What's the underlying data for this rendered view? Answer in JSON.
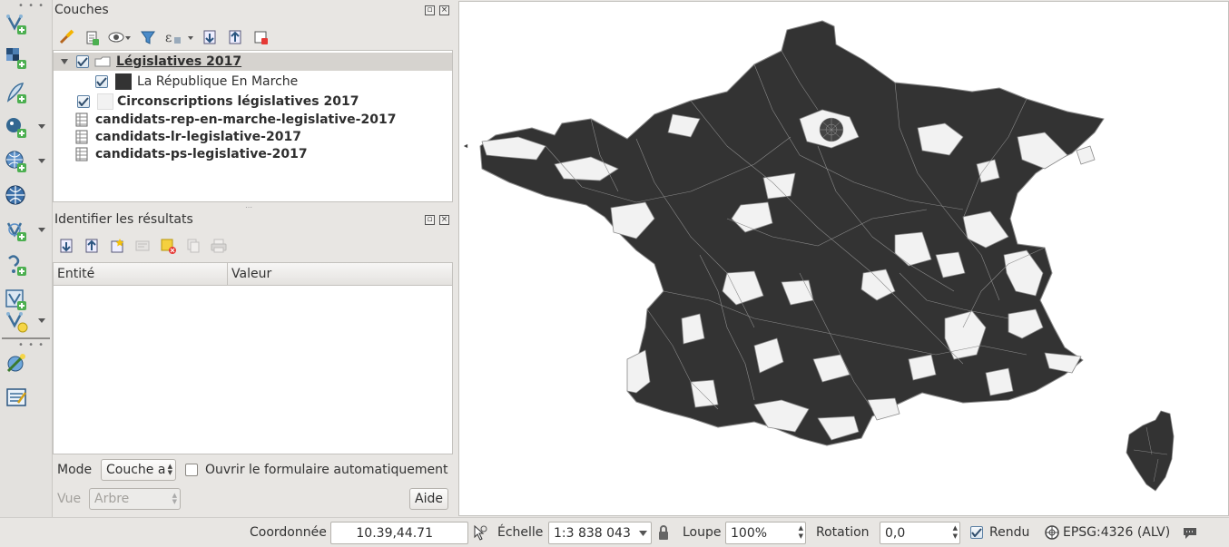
{
  "layers_panel": {
    "title": "Couches",
    "tree": [
      {
        "label": "Législatives 2017"
      },
      {
        "label": "La République En Marche"
      },
      {
        "label": "Circonscriptions législatives 2017"
      },
      {
        "label": "candidats-rep-en-marche-legislative-2017"
      },
      {
        "label": "candidats-lr-legislative-2017"
      },
      {
        "label": "candidats-ps-legislative-2017"
      }
    ],
    "colors": {
      "rem_fill": "#333333",
      "circ_fill": "#f2f2f2",
      "selected_row": "#d6d3cf"
    }
  },
  "identify_panel": {
    "title": "Identifier les résultats",
    "col_entity": "Entité",
    "col_value": "Valeur",
    "mode_label": "Mode",
    "mode_value": "Couche a",
    "auto_open_label": "Ouvrir le formulaire automatiquement",
    "view_label": "Vue",
    "view_value": "Arbre",
    "help_button": "Aide"
  },
  "map": {
    "fill_color": "#333333",
    "empty_color": "#f2f2f2",
    "border_color": "#8a8a8a"
  },
  "statusbar": {
    "coord_label": "Coordonnée",
    "coord_value": "10.39,44.71",
    "scale_label": "Échelle",
    "scale_value": "1:3 838 043",
    "magnifier_label": "Loupe",
    "magnifier_value": "100%",
    "rotation_label": "Rotation",
    "rotation_value": "0,0",
    "render_label": "Rendu",
    "crs_label": "EPSG:4326 (ALV)"
  }
}
